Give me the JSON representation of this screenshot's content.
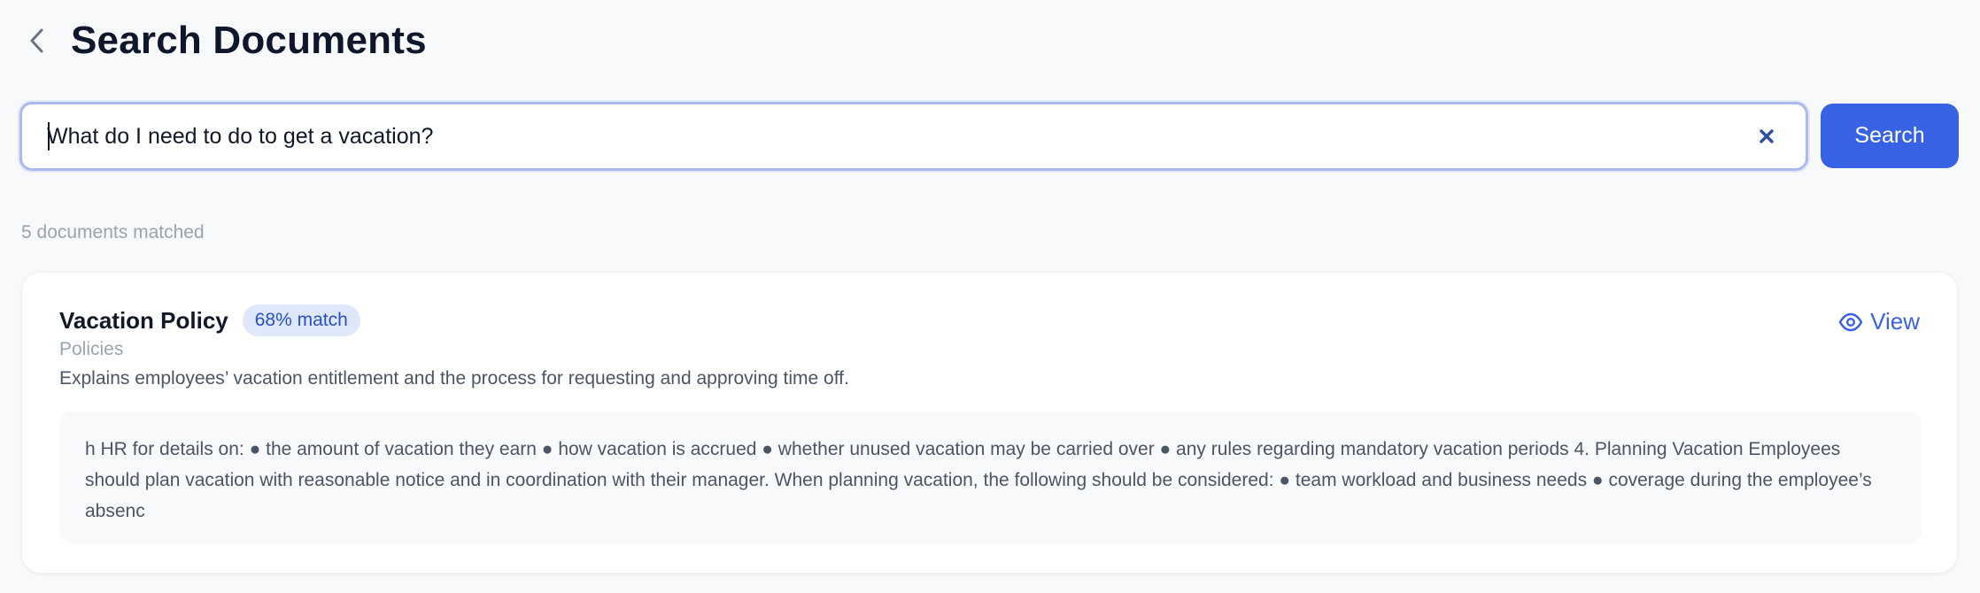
{
  "header": {
    "title": "Search Documents",
    "back_icon": "chevron-left-icon"
  },
  "search": {
    "value": "What do I need to do to get a vacation?",
    "placeholder": "",
    "clear_icon": "close-icon",
    "button_label": "Search"
  },
  "results": {
    "count_text": "5 documents matched",
    "items": [
      {
        "title": "Vacation Policy",
        "match": "68% match",
        "category": "Policies",
        "description": "Explains employees’ vacation entitlement and the process for requesting and approving time off.",
        "excerpt": "h HR for details on: ● the amount of vacation they earn ● how vacation is accrued ● whether unused vacation may be carried over ● any rules regarding mandatory vacation periods 4. Planning Vacation Employees should plan vacation with reasonable notice and in coordination with their manager. When planning vacation, the following should be considered: ● team workload and business needs ● coverage during the employee’s absenc",
        "view_label": "View",
        "view_icon": "eye-icon"
      }
    ]
  },
  "colors": {
    "accent": "#3662e3",
    "badge_bg": "#dfe8fb",
    "badge_text": "#2a4fbf",
    "page_bg": "#f8f9fb"
  }
}
